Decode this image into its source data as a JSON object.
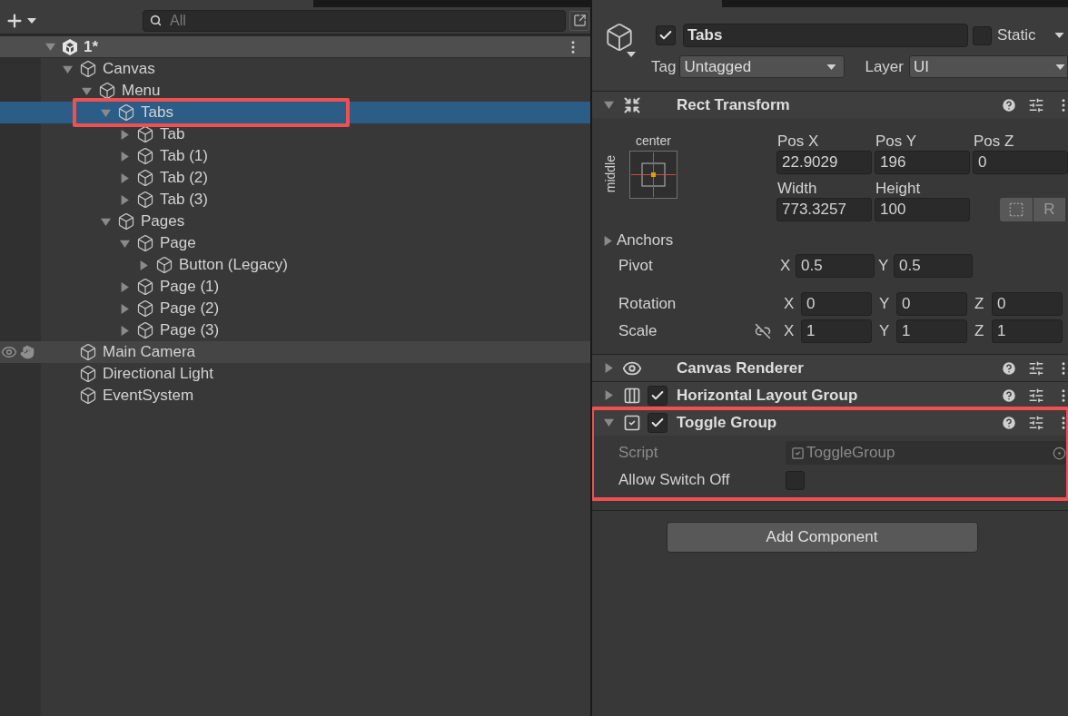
{
  "hierarchy": {
    "search": {
      "placeholder": "All"
    },
    "scene": {
      "name": "1*",
      "expanded": true,
      "children": [
        {
          "name": "Canvas",
          "kind": "branch",
          "expanded": true,
          "selected": false,
          "hovered": false,
          "highlighted": false,
          "children": [
            {
              "name": "Menu",
              "kind": "branch",
              "expanded": true,
              "selected": false,
              "hovered": false,
              "highlighted": false,
              "children": [
                {
                  "name": "Tabs",
                  "kind": "branch",
                  "expanded": true,
                  "selected": true,
                  "hovered": false,
                  "highlighted": true,
                  "children": [
                    {
                      "name": "Tab",
                      "kind": "branch",
                      "expanded": false,
                      "selected": false,
                      "hovered": false,
                      "highlighted": false
                    },
                    {
                      "name": "Tab (1)",
                      "kind": "branch",
                      "expanded": false,
                      "selected": false,
                      "hovered": false,
                      "highlighted": false
                    },
                    {
                      "name": "Tab (2)",
                      "kind": "branch",
                      "expanded": false,
                      "selected": false,
                      "hovered": false,
                      "highlighted": false
                    },
                    {
                      "name": "Tab (3)",
                      "kind": "branch",
                      "expanded": false,
                      "selected": false,
                      "hovered": false,
                      "highlighted": false
                    }
                  ]
                },
                {
                  "name": "Pages",
                  "kind": "branch",
                  "expanded": true,
                  "selected": false,
                  "hovered": false,
                  "highlighted": false,
                  "children": [
                    {
                      "name": "Page",
                      "kind": "branch",
                      "expanded": true,
                      "selected": false,
                      "hovered": false,
                      "highlighted": false,
                      "children": [
                        {
                          "name": "Button (Legacy)",
                          "kind": "branch",
                          "expanded": false,
                          "selected": false,
                          "hovered": false,
                          "highlighted": false
                        }
                      ]
                    },
                    {
                      "name": "Page (1)",
                      "kind": "branch",
                      "expanded": false,
                      "selected": false,
                      "hovered": false,
                      "highlighted": false
                    },
                    {
                      "name": "Page (2)",
                      "kind": "branch",
                      "expanded": false,
                      "selected": false,
                      "hovered": false,
                      "highlighted": false
                    },
                    {
                      "name": "Page (3)",
                      "kind": "branch",
                      "expanded": false,
                      "selected": false,
                      "hovered": false,
                      "highlighted": false
                    }
                  ]
                }
              ]
            }
          ]
        },
        {
          "name": "Main Camera",
          "kind": "leaf",
          "selected": false,
          "hovered": true,
          "highlighted": false
        },
        {
          "name": "Directional Light",
          "kind": "leaf",
          "selected": false,
          "hovered": false,
          "highlighted": false
        },
        {
          "name": "EventSystem",
          "kind": "leaf",
          "selected": false,
          "hovered": false,
          "highlighted": false
        }
      ]
    }
  },
  "inspector": {
    "object": {
      "active": true,
      "name": "Tabs",
      "static": false,
      "static_label": "Static",
      "tag_label": "Tag",
      "tag": "Untagged",
      "layer_label": "Layer",
      "layer": "UI"
    },
    "components": [
      {
        "kind": "rect_transform",
        "title": "Rect Transform",
        "expanded": true,
        "highlighted": false,
        "anchor": {
          "horizontal": "center",
          "vertical": "middle"
        },
        "pos": [
          {
            "label": "Pos X",
            "value": "22.9029"
          },
          {
            "label": "Pos Y",
            "value": "196"
          },
          {
            "label": "Pos Z",
            "value": "0"
          }
        ],
        "size": [
          {
            "label": "Width",
            "value": "773.3257"
          },
          {
            "label": "Height",
            "value": "100"
          }
        ],
        "raw_label": "R",
        "anchors": {
          "label": "Anchors",
          "expanded": false
        },
        "rows": [
          {
            "label": "Pivot",
            "fields": [
              {
                "axis": "X",
                "value": "0.5"
              },
              {
                "axis": "Y",
                "value": "0.5"
              }
            ]
          },
          {
            "label": "Rotation",
            "fields": [
              {
                "axis": "X",
                "value": "0"
              },
              {
                "axis": "Y",
                "value": "0"
              },
              {
                "axis": "Z",
                "value": "0"
              }
            ]
          },
          {
            "label": "Scale",
            "constrained": false,
            "fields": [
              {
                "axis": "X",
                "value": "1"
              },
              {
                "axis": "Y",
                "value": "1"
              },
              {
                "axis": "Z",
                "value": "1"
              }
            ]
          }
        ]
      },
      {
        "kind": "canvas_renderer",
        "title": "Canvas Renderer",
        "expanded": false,
        "highlighted": false
      },
      {
        "kind": "horizontal_layout",
        "title": "Horizontal Layout Group",
        "expanded": false,
        "enabled": true,
        "highlighted": false
      },
      {
        "kind": "toggle_group",
        "title": "Toggle Group",
        "expanded": true,
        "enabled": true,
        "highlighted": true,
        "fields": [
          {
            "kind": "script",
            "label": "Script",
            "value": "ToggleGroup"
          },
          {
            "kind": "checkbox",
            "label": "Allow Switch Off",
            "checked": false
          }
        ]
      }
    ],
    "add_component": "Add Component"
  }
}
